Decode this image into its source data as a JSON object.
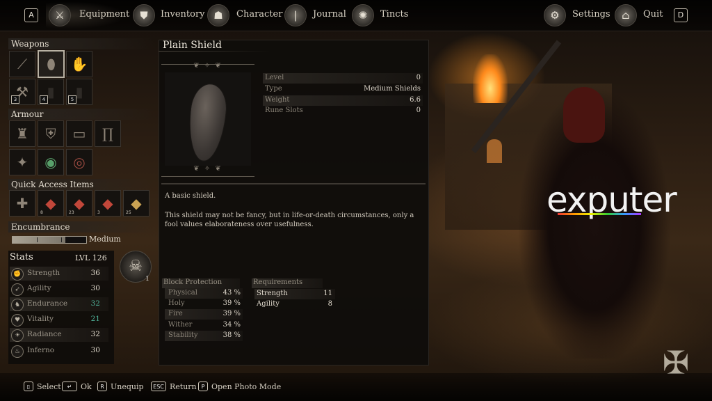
{
  "topbar": {
    "left_key": "A",
    "right_key": "D",
    "tabs": [
      {
        "label": "Equipment",
        "icon": "equipment-icon"
      },
      {
        "label": "Inventory",
        "icon": "inventory-icon"
      },
      {
        "label": "Character",
        "icon": "character-icon"
      },
      {
        "label": "Journal",
        "icon": "journal-icon"
      },
      {
        "label": "Tincts",
        "icon": "tincts-icon"
      }
    ],
    "settings_label": "Settings",
    "quit_label": "Quit"
  },
  "weapons": {
    "title": "Weapons",
    "slots": [
      {
        "icon": "spear-icon"
      },
      {
        "icon": "shield-icon",
        "selected": true
      },
      {
        "icon": "hand-icon"
      },
      {
        "icon": "axe-icon",
        "key": "3"
      },
      {
        "icon": "empty-slot-icon",
        "key": "4"
      },
      {
        "icon": "empty-slot-icon",
        "key": "5"
      }
    ]
  },
  "armour": {
    "title": "Armour",
    "slots": [
      {
        "icon": "helmet-icon"
      },
      {
        "icon": "chest-armour-icon"
      },
      {
        "icon": "gauntlets-icon"
      },
      {
        "icon": "leg-armour-icon"
      },
      {
        "icon": "amulet-icon"
      },
      {
        "icon": "green-ring-icon"
      },
      {
        "icon": "red-ring-icon"
      }
    ]
  },
  "quick_access": {
    "title": "Quick Access Items",
    "slots": [
      {
        "icon": "lantern-tool-icon"
      },
      {
        "icon": "red-potion-icon",
        "qty": "8"
      },
      {
        "icon": "red-potion-icon",
        "qty": "23"
      },
      {
        "icon": "red-potion-icon",
        "qty": "3"
      },
      {
        "icon": "gold-potion-icon",
        "qty": "25"
      }
    ]
  },
  "encumbrance": {
    "title": "Encumbrance",
    "level": "Medium",
    "fill_fraction": 0.72
  },
  "stats": {
    "title": "Stats",
    "level_label": "LVL 126",
    "rows": [
      {
        "name": "Strength",
        "value": "36",
        "icon": "strength-icon"
      },
      {
        "name": "Agility",
        "value": "30",
        "icon": "agility-icon"
      },
      {
        "name": "Endurance",
        "value": "32",
        "icon": "endurance-icon",
        "color": "#4fb39a"
      },
      {
        "name": "Vitality",
        "value": "21",
        "icon": "vitality-icon",
        "color": "#4fb39a"
      },
      {
        "name": "Radiance",
        "value": "32",
        "icon": "radiance-icon"
      },
      {
        "name": "Inferno",
        "value": "30",
        "icon": "inferno-icon"
      }
    ],
    "points_available": "1"
  },
  "item": {
    "name": "Plain Shield",
    "properties": [
      {
        "key": "Level",
        "value": "0"
      },
      {
        "key": "Type",
        "value": "Medium Shields"
      },
      {
        "key": "Weight",
        "value": "6.6"
      },
      {
        "key": "Rune Slots",
        "value": "0"
      }
    ],
    "desc_short": "A basic shield.",
    "desc_long": "This shield may not be fancy, but in life-or-death circumstances, only a fool values elaborateness over usefulness.",
    "block_protection": {
      "title": "Block Protection",
      "rows": [
        {
          "key": "Physical",
          "value": "43 %"
        },
        {
          "key": "Holy",
          "value": "39 %"
        },
        {
          "key": "Fire",
          "value": "39 %"
        },
        {
          "key": "Wither",
          "value": "34 %"
        },
        {
          "key": "Stability",
          "value": "38 %"
        }
      ]
    },
    "requirements": {
      "title": "Requirements",
      "rows": [
        {
          "key": "Strength",
          "value": "11"
        },
        {
          "key": "Agility",
          "value": "8"
        }
      ]
    }
  },
  "watermark": "exputer",
  "bottom_hints": [
    {
      "key": "mouse",
      "label": "Select"
    },
    {
      "key": "↵",
      "label": "Ok"
    },
    {
      "key": "R",
      "label": "Unequip"
    },
    {
      "key": "ESC",
      "label": "Return"
    },
    {
      "key": "P",
      "label": "Open Photo Mode"
    }
  ]
}
